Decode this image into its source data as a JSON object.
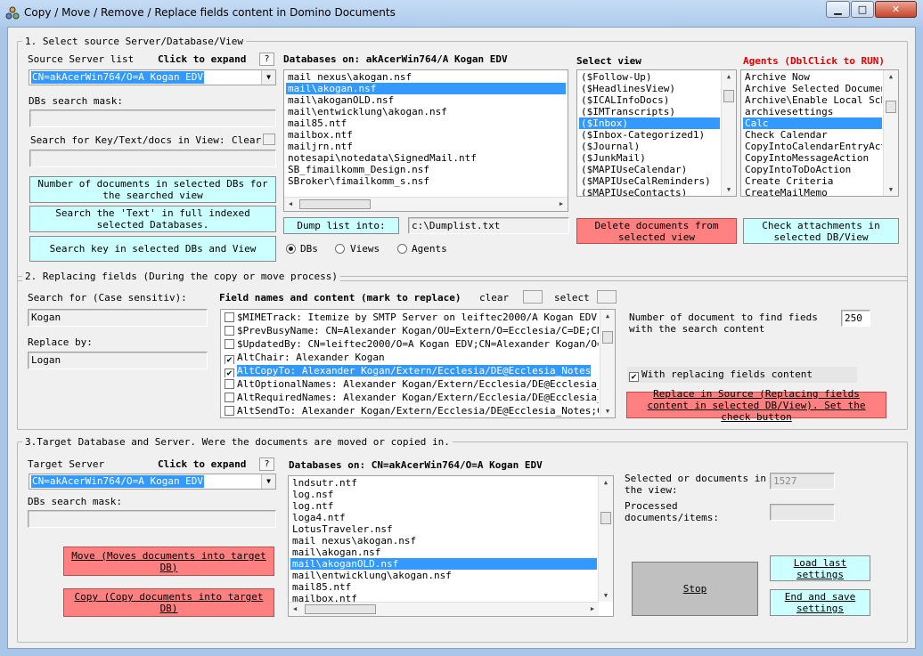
{
  "window": {
    "title": "Copy / Move / Remove / Replace fields content in Domino Documents",
    "min_symbol": "▁",
    "max_symbol": "□",
    "close_symbol": "✕"
  },
  "section1": {
    "legend": "1. Select source Server/Database/View",
    "source_server_label": "Source Server list",
    "click_to_expand": "Click to expand",
    "help": "?",
    "source_server_value": "CN=akAcerWin764/O=A Kogan EDV",
    "dbs_search_mask_label": "DBs search mask:",
    "dbs_search_mask_value": "",
    "search_key_label": "Search for Key/Text/docs in View:",
    "clear_label": "Clear",
    "search_key_value": "",
    "btn_number_docs": "Number of documents in selected DBs for the searched view",
    "btn_search_text": "Search the 'Text' in full indexed selected Databases.",
    "btn_search_key": "Search key in selected DBs and View",
    "databases_label": "Databases on: akAcerWin764/A Kogan EDV",
    "databases": [
      "mail nexus\\akogan.nsf",
      "mail\\akogan.nsf",
      "mail\\akoganOLD.nsf",
      "mail\\entwicklung\\akogan.nsf",
      "mail85.ntf",
      "mailbox.ntf",
      "mailjrn.ntf",
      "notesapi\\notedata\\SignedMail.ntf",
      "SB_fimailkomm_Design.nsf",
      "SBroker\\fimailkomm_s.nsf"
    ],
    "dump_button": "Dump list into:",
    "dump_path": "c:\\Dumplist.txt",
    "radio_dbs": "DBs",
    "radio_views": "Views",
    "radio_agents": "Agents",
    "select_view_label": "Select view",
    "views": [
      "($Follow-Up)",
      "($HeadlinesView)",
      "($ICALInfoDocs)",
      "($IMTranscripts)",
      "($Inbox)",
      "($Inbox-Categorized1)",
      "($Journal)",
      "($JunkMail)",
      "($MAPIUseCalendar)",
      "($MAPIUseCalReminders)",
      "($MAPIUseContacts)"
    ],
    "btn_delete_docs": "Delete documents from selected view",
    "agents_label": "Agents (DblClick to RUN)",
    "agents_color": "#e00000",
    "agents": [
      "Archive Now",
      "Archive Selected Documents",
      "Archive\\Enable Local Sched",
      "archivesettings",
      "Calc",
      "Check Calendar",
      "CopyIntoCalendarEntryActio",
      "CopyIntoMessageAction",
      "CopyIntoToDoAction",
      "Create Criteria",
      "CreateMailMemo"
    ],
    "btn_check_attachments": "Check attachments in selected DB/View"
  },
  "section2": {
    "legend": "2. Replacing fields  (During the copy or move process)",
    "search_for_label": "Search for (Case sensitiv):",
    "search_for_value": "Kogan",
    "replace_by_label": "Replace by:",
    "replace_by_value": "Logan",
    "field_names_label": "Field names and content (mark to replace)",
    "clear_label": "clear",
    "select_label": "select",
    "fields": [
      {
        "checked": false,
        "text": "$MIMETrack: Itemize by SMTP Server on leiftec2000/A Kogan EDV(Releas"
      },
      {
        "checked": false,
        "text": "$PrevBusyName: CN=Alexander Kogan/OU=Extern/O=Ecclesia/C=DE;CN=Alexa"
      },
      {
        "checked": false,
        "text": "$UpdatedBy: CN=leiftec2000/O=A Kogan EDV;CN=Alexander Kogan/O=A Koga"
      },
      {
        "checked": true,
        "text": "AltChair: Alexander Kogan"
      },
      {
        "checked": true,
        "text": "AltCopyTo: Alexander Kogan/Extern/Ecclesia/DE@Ecclesia_Notes"
      },
      {
        "checked": false,
        "text": "AltOptionalNames: Alexander Kogan/Extern/Ecclesia/DE@Ecclesia_Notes"
      },
      {
        "checked": false,
        "text": "AltRequiredNames: Alexander Kogan/Extern/Ecclesia/DE@Ecclesia_Notes;"
      },
      {
        "checked": false,
        "text": "AltSendTo: Alexander Kogan/Extern/Ecclesia/DE@Ecclesia_Notes;CN=Marc"
      }
    ],
    "num_docs_label": "Number of document to find fieds with the search content",
    "num_docs_value": "250",
    "with_replacing_label": "With replacing fields content",
    "with_replacing_checked": true,
    "btn_replace_source": "Replace in Source (Replacing fields content in selected DB/View). Set the check button"
  },
  "section3": {
    "legend": "3.Target Database and Server. Were the documents are moved or copied in.",
    "target_server_label": "Target Server",
    "click_to_expand": "Click to expand",
    "help": "?",
    "target_server_value": "CN=akAcerWin764/O=A Kogan EDV",
    "dbs_search_mask_label": "DBs search mask:",
    "dbs_search_mask_value": "",
    "btn_move": "Move (Moves documents into target DB)",
    "btn_copy": "Copy (Copy documents into target DB)",
    "databases_label": "Databases on: CN=akAcerWin764/O=A Kogan EDV",
    "databases": [
      "lndsutr.ntf",
      "log.nsf",
      "log.ntf",
      "loga4.ntf",
      "LotusTraveler.nsf",
      "mail nexus\\akogan.nsf",
      "mail\\akogan.nsf",
      "mail\\akoganOLD.nsf",
      "mail\\entwicklung\\akogan.nsf",
      "mail85.ntf",
      "mailbox.ntf"
    ],
    "selected_docs_label": "Selected or documents in the view:",
    "selected_docs_value": "1527",
    "processed_label": "Processed documents/items:",
    "processed_value": "",
    "btn_stop": "Stop",
    "btn_load_settings": "Load last settings",
    "btn_save_settings": "End and save settings"
  },
  "colors": {
    "cyan_button": "#ccffff",
    "red_button": "#ff8080",
    "selection": "#3399ff"
  }
}
